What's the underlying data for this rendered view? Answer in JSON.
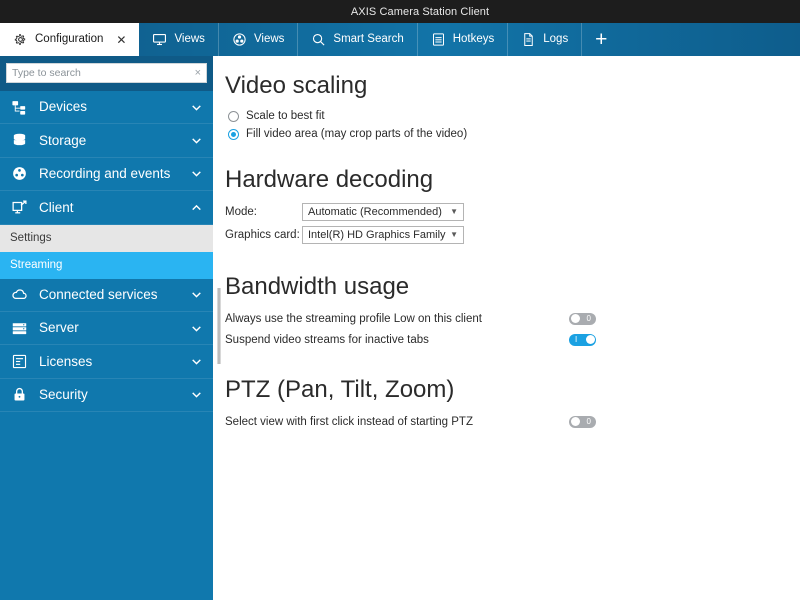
{
  "window": {
    "title": "AXIS Camera Station Client"
  },
  "tabs": [
    {
      "label": "Configuration",
      "icon": "gear-icon",
      "active": true,
      "closable": true
    },
    {
      "label": "Views",
      "icon": "monitor-icon",
      "active": false,
      "closable": false
    },
    {
      "label": "Views",
      "icon": "film-icon",
      "active": false,
      "closable": false
    },
    {
      "label": "Smart Search",
      "icon": "search-magnifier-icon",
      "active": false,
      "closable": false
    },
    {
      "label": "Hotkeys",
      "icon": "keyboard-icon",
      "active": false,
      "closable": false
    },
    {
      "label": "Logs",
      "icon": "document-icon",
      "active": false,
      "closable": false
    }
  ],
  "tab_add_label": "+",
  "sidebar": {
    "search": {
      "placeholder": "Type to search",
      "value": "",
      "clear_label": "×"
    },
    "items": [
      {
        "label": "Devices",
        "icon": "devices-icon",
        "state": "collapsed"
      },
      {
        "label": "Storage",
        "icon": "database-icon",
        "state": "collapsed"
      },
      {
        "label": "Recording and events",
        "icon": "film-reel-icon",
        "state": "collapsed"
      },
      {
        "label": "Client",
        "icon": "client-monitor-icon",
        "state": "expanded"
      }
    ],
    "client_children": [
      {
        "label": "Settings",
        "selected": false
      },
      {
        "label": "Streaming",
        "selected": true
      }
    ],
    "items_after": [
      {
        "label": "Connected services",
        "icon": "cloud-icon",
        "state": "collapsed"
      },
      {
        "label": "Server",
        "icon": "server-icon",
        "state": "collapsed"
      },
      {
        "label": "Licenses",
        "icon": "license-certificate-icon",
        "state": "collapsed"
      },
      {
        "label": "Security",
        "icon": "lock-icon",
        "state": "collapsed"
      }
    ]
  },
  "content": {
    "video_scaling": {
      "title": "Video scaling",
      "options": [
        {
          "label": "Scale to best fit",
          "selected": false
        },
        {
          "label": "Fill video area (may crop parts of the video)",
          "selected": true
        }
      ]
    },
    "hardware_decoding": {
      "title": "Hardware decoding",
      "mode_label": "Mode:",
      "mode_value": "Automatic (Recommended)",
      "graphics_label": "Graphics card:",
      "graphics_value": "Intel(R) HD Graphics Family",
      "arrow": "▼"
    },
    "bandwidth_usage": {
      "title": "Bandwidth usage",
      "toggles": [
        {
          "label": "Always use the streaming profile Low on this client",
          "on": false,
          "mark": "0"
        },
        {
          "label": "Suspend video streams for inactive tabs",
          "on": true,
          "mark": "I"
        }
      ]
    },
    "ptz": {
      "title": "PTZ (Pan, Tilt, Zoom)",
      "toggles": [
        {
          "label": "Select view with first click instead of starting PTZ",
          "on": false,
          "mark": "0"
        }
      ]
    }
  },
  "colors": {
    "titlebar_bg": "#1d1d1d",
    "tab_bg": "#1274a8",
    "sidebar_bg": "#1078ad",
    "accent": "#1ba1e2",
    "selected_sub": "#2ab4f2"
  }
}
